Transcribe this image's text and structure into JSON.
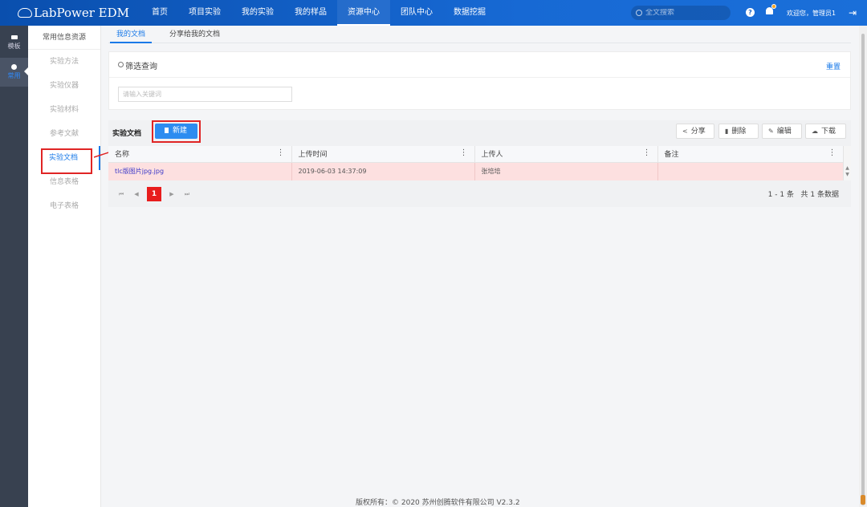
{
  "header": {
    "brand": "LabPower EDM",
    "nav": [
      {
        "label": "首页"
      },
      {
        "label": "项目实验"
      },
      {
        "label": "我的实验"
      },
      {
        "label": "我的样品"
      },
      {
        "label": "资源中心",
        "active": true
      },
      {
        "label": "团队中心"
      },
      {
        "label": "数据挖掘"
      }
    ],
    "search_placeholder": "全文搜索",
    "help_label": "?",
    "welcome": "欢迎您，管理员1",
    "logout_label": "⇥"
  },
  "rail": {
    "items": [
      {
        "label": "模板"
      },
      {
        "label": "常用",
        "active": true
      }
    ]
  },
  "sidebar": {
    "title": "常用信息资源",
    "items": [
      {
        "label": "实验方法"
      },
      {
        "label": "实验仪器"
      },
      {
        "label": "实验材料"
      },
      {
        "label": "参考文献"
      },
      {
        "label": "实验文档",
        "active": true
      },
      {
        "label": "信息表格"
      },
      {
        "label": "电子表格"
      }
    ]
  },
  "tabs": [
    {
      "label": "我的文档",
      "active": true
    },
    {
      "label": "分享给我的文档"
    }
  ],
  "filter": {
    "title": "筛选查询",
    "reset_label": "重置",
    "keyword_placeholder": "请输入关键词"
  },
  "docs": {
    "title": "实验文档",
    "new_label": "新建",
    "toolbar": {
      "share_label": "分享",
      "delete_label": "删除",
      "edit_label": "编辑",
      "download_label": "下载"
    },
    "columns": [
      "名称",
      "上传时间",
      "上传人",
      "备注"
    ],
    "rows": [
      {
        "name": "tlc版图片jpg.jpg",
        "time": "2019-06-03 14:37:09",
        "uploader": "张培培",
        "note": ""
      }
    ],
    "pager": {
      "current": "1",
      "range": "1 - 1 条",
      "total": "共 1 条数据"
    }
  },
  "footer": "版权所有：© 2020 苏州创腾软件有限公司   V2.3.2",
  "colors": {
    "header_bg": "#1769d4",
    "accent": "#1a7ae8",
    "primary_button": "#2d8cf0",
    "highlight_row": "#fde0e0",
    "annotation_red": "#e02525"
  }
}
